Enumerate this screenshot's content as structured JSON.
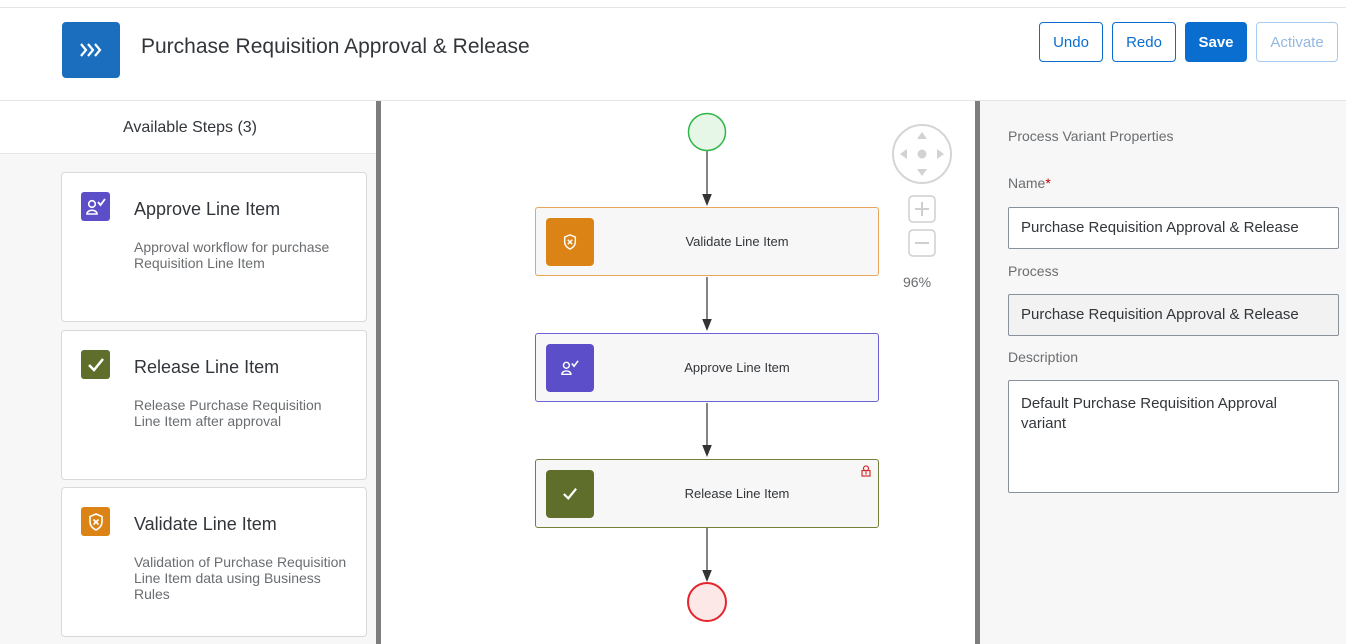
{
  "header": {
    "title": "Purchase Requisition Approval & Release",
    "buttons": {
      "undo": "Undo",
      "redo": "Redo",
      "save": "Save",
      "activate": "Activate"
    }
  },
  "left_panel": {
    "title": "Available Steps (3)",
    "steps": [
      {
        "title": "Approve Line Item",
        "description": "Approval workflow for purchase Requisition Line Item",
        "icon": "approver-icon",
        "color": "#5b4ec8"
      },
      {
        "title": "Release Line Item",
        "description": "Release Purchase Requisition Line Item after approval",
        "icon": "checkmark-icon",
        "color": "#5f6f2b"
      },
      {
        "title": "Validate Line Item",
        "description": "Validation of Purchase Requisition Line Item data using Business Rules",
        "icon": "shield-icon",
        "color": "#dc8316"
      }
    ]
  },
  "canvas": {
    "nodes": [
      {
        "label": "Validate Line Item",
        "icon": "shield-icon",
        "color": "#dc8316",
        "border": "#e8a55b"
      },
      {
        "label": "Approve Line Item",
        "icon": "approver-icon",
        "color": "#5b4ec8",
        "border": "#6c62d6"
      },
      {
        "label": "Release Line Item",
        "icon": "checkmark-icon",
        "color": "#5f6f2b",
        "border": "#71803a"
      }
    ],
    "zoom": "96%",
    "start_event_color": "#2fb548",
    "end_event_color": "#e5242b"
  },
  "right_panel": {
    "title": "Process Variant Properties",
    "name_label": "Name",
    "required_marker": "*",
    "name_value": "Purchase Requisition Approval & Release",
    "process_label": "Process",
    "process_value": "Purchase Requisition Approval & Release",
    "description_label": "Description",
    "description_value": "Default Purchase Requisition Approval variant"
  }
}
